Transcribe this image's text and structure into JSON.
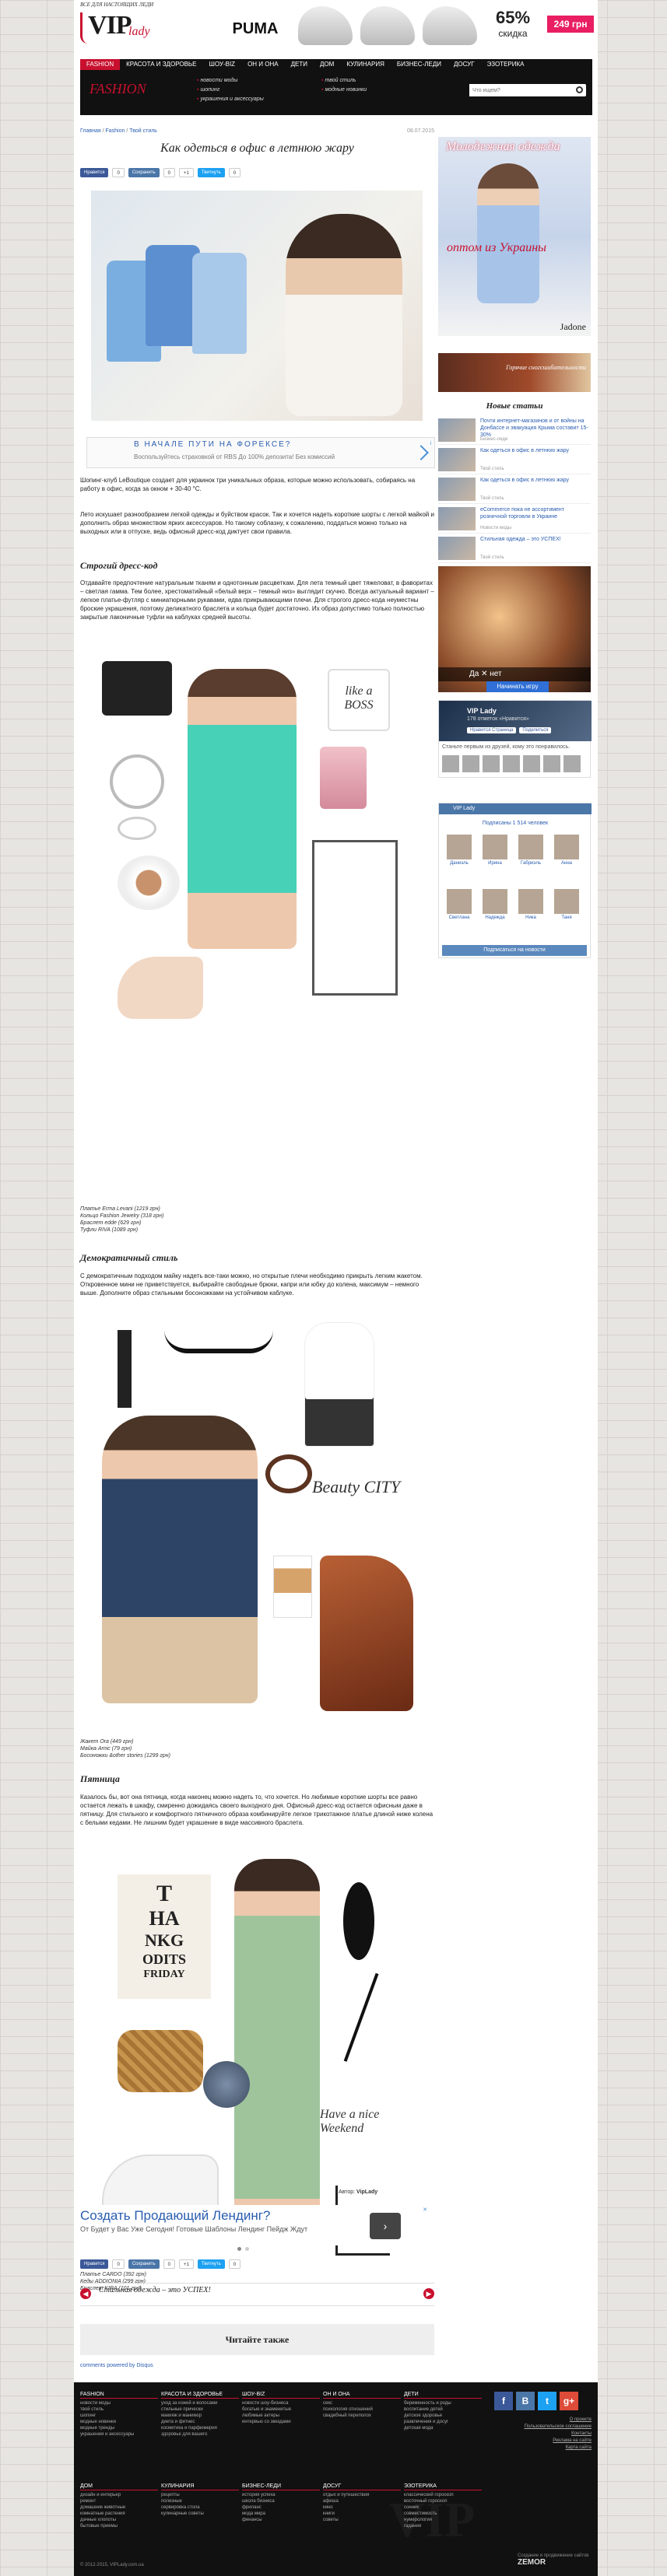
{
  "logo": {
    "tagline": "ВСЕ ДЛЯ НАСТОЯЩИХ ЛЕДИ",
    "vip": "VIP",
    "lady": "lady"
  },
  "banner": {
    "brand": "PUMA",
    "discount": "65%",
    "discount_label": "скидка",
    "price": "249 грн"
  },
  "nav": [
    "FASHION",
    "КРАСОТА И ЗДОРОВЬЕ",
    "ШОУ-BIZ",
    "ОН И ОНА",
    "ДЕТИ",
    "ДОМ",
    "КУЛИНАРИЯ",
    "БИЗНЕС-ЛЕДИ",
    "ДОСУГ",
    "ЭЗОТЕРИКА"
  ],
  "subnav": {
    "title": "FASHION",
    "col1": [
      "новости моды",
      "шопинг",
      "украшения и аксессуары"
    ],
    "col2": [
      "твой стиль",
      "модные новинки"
    ],
    "search_placeholder": "Что ищем?"
  },
  "breadcrumb": {
    "home": "Главная",
    "sep": " / ",
    "section": "Fashion",
    "sub": "Твой стиль"
  },
  "date": "08.07.2015",
  "title": "Как одеться в офис в летнюю жару",
  "share": {
    "fb": "Нравится",
    "fb_count": "0",
    "vk": "Сохранить",
    "vk_count": "0",
    "tw": "Твитнуть",
    "tw_count": "0",
    "plus": "+1"
  },
  "ad_small": {
    "title": "В НАЧАЛЕ ПУТИ НА ФОРЕКСЕ?",
    "sub": "Воспользуйтесь страховкой от RBS До 100% депозита! Без комиссий",
    "info": "i"
  },
  "intro": "Шопинг-клуб LeBoutique создает для украинок три уникальных образа, которые можно использовать, собираясь на работу в офис, когда за окном + 30-40 °С.",
  "para1": "Лето искушает разнообразием легкой одежды и буйством красок. Так и хочется надеть короткие шорты с легкой майкой и дополнить образ множеством ярких аксессуаров. Но такому соблазну, к сожалению, поддаться можно только на выходных или в отпуске, ведь офисный дресс-код диктует свои правила.",
  "section1": {
    "title": "Строгий дресс-код",
    "text": "Отдавайте предпочтение натуральным тканям и однотонным расцветкам. Для лета темный цвет тяжеловат, в фаворитах – светлая гамма. Тем более, хрестоматийный «белый верх – темный низ» выглядит скучно. Всегда актуальный вариант – легкое платье-футляр с миниатюрными рукавами, едва прикрывающими плечи. Для строгого дресс-кода неуместны броские украшения, поэтому деликатного браслета и кольца будет достаточно. Их образ допустимо только полностью закрытые лаконичные туфли на каблуках средней высоты.",
    "caps": [
      "Платье Erma Levani (1219 грн)",
      "Кольцо Fashion Jewelry (318 грн)",
      "Браслет edde (629 грн)",
      "Туфли RIVA (1089 грн)"
    ]
  },
  "section2": {
    "title": "Демократичный стиль",
    "text": "С демократичным подходом майку надеть все-таки можно, но открытые плечи необходимо прикрыть легким жакетом. Откровенное мини не приветствуется, выбирайте свободные брюки, капри или юбку до колена, максимум – немного выше. Дополните образ стильными босоножками на устойчивом каблуке.",
    "caps": [
      "Жакет Ora (449 грн)",
      "Майка Arnic (79 грн)",
      "Босоножки &other stories (1299 грн)"
    ]
  },
  "section3": {
    "title": "Пятница",
    "text": "Казалось бы, вот она пятница, когда наконец можно надеть то, что хочется. Но любимые короткие шорты все равно остается лежать в шкафу, смиренно дожидаясь своего выходного дня. Офисный дресс-код остается офисным даже в пятницу. Для стильного и комфортного пятничного образа комбинируйте легкое трикотажное платье длиной ниже колена с белыми кедами. Не лишним будет украшение в виде массивного браслета.",
    "caps": [
      "Платье CARDO (392 грн)",
      "Кеды ADDIONIA (299 грн)",
      "Браслет KIRA (101 грн)"
    ]
  },
  "collage_text": {
    "boss": "like a BOSS",
    "beauty": "Beauty CITY",
    "weekend": "Have a nice Weekend",
    "chart": [
      "T",
      "HA",
      "NKG",
      "ODITS",
      "FRIDAY"
    ]
  },
  "author": {
    "label": "Автор:",
    "name": "VipLady"
  },
  "ad_big": {
    "title": "Создать Продающий Лендинг?",
    "sub": "От Будет у Вас Уже Сегодня! Готовые Шаблоны Лендинг Пейдж Ждут",
    "x": "✕",
    "btn": "›"
  },
  "prev_post": {
    "text": "Стильная одежда – это УСПЕХ!"
  },
  "read_also": "Читайте также",
  "disqus": "comments powered by Disqus",
  "side": {
    "ad1": {
      "title": "Молодежная одежда",
      "offer": "оптом из Украины",
      "brand": "Jadone"
    },
    "ad2": {
      "text": "Горячие сногсшибательности"
    },
    "new_title": "Новые статьи",
    "news": [
      {
        "title": "Почти интернет-магазинов и от войны на Донбассе и эвакуация Крыма составит 15-30%",
        "cat": "Бизнес-леди"
      },
      {
        "title": "Как одеться в офис в летнюю жару",
        "cat": "Твой стиль"
      },
      {
        "title": "Как одеться в офис в летнюю жару",
        "cat": "Твой стиль"
      },
      {
        "title": "eCommerce пока не ассортимент розничной торговли в Украине",
        "cat": "Новости моды"
      },
      {
        "title": "Стильная одежда – это УСПЕХ!",
        "cat": "Твой стиль"
      }
    ],
    "ad3": {
      "bar": "Да  ✕  нет",
      "btn": "Начинать игру"
    },
    "fb": {
      "name": "VIP Lady",
      "count": "178 отметок «Нравится»",
      "like": "Нравится Страница",
      "share": "Поделиться",
      "friends": "Станьте первым из друзей, кому это понравилось."
    },
    "vk": {
      "title": "VIP Lady",
      "sub": "Подписаны 1 514 человек",
      "names": [
        "Даниэль",
        "Ирина",
        "Габриэль",
        "Анна",
        "Светлана",
        "Надежда",
        "Ника",
        "Таня"
      ],
      "btn": "Подписаться на новости"
    }
  },
  "footer": {
    "cols": [
      {
        "hd": "FASHION",
        "items": [
          "новости моды",
          "твой стиль",
          "шопинг",
          "модные новинки",
          "модные тренды",
          "украшения и аксессуары"
        ]
      },
      {
        "hd": "КРАСОТА И ЗДОРОВЬЕ",
        "items": [
          "уход за кожей и волосами",
          "стильные прически",
          "макияж и маникюр",
          "диета и фитнес",
          "косметика и парфюмерия",
          "здоровье для вашего"
        ]
      },
      {
        "hd": "ШОУ-BIZ",
        "items": [
          "новости шоу-бизнеса",
          "богатые и знаменитые",
          "любимые актеры",
          "интервью со звездами"
        ]
      },
      {
        "hd": "ОН И ОНА",
        "items": [
          "секс",
          "психология отношений",
          "свадебный переполох"
        ]
      },
      {
        "hd": "ДЕТИ",
        "items": [
          "беременность и роды",
          "воспитание детей",
          "детское здоровье",
          "развлечения и досуг",
          "детская мода"
        ]
      },
      {
        "hd": "ДОМ",
        "items": [
          "дизайн и интерьер",
          "ремонт",
          "домашние животные",
          "комнатные растения",
          "дачные хлопоты",
          "бытовые приемы"
        ]
      },
      {
        "hd": "КУЛИНАРИЯ",
        "items": [
          "рецепты",
          "полезные",
          "сервировка стола",
          "кулинарные советы"
        ]
      },
      {
        "hd": "БИЗНЕС-ЛЕДИ",
        "items": [
          "история успеха",
          "школа бизнеса",
          "фриланс",
          "мода мира",
          "финансы"
        ]
      },
      {
        "hd": "ДОСУГ",
        "items": [
          "отдых и путешествия",
          "афиша",
          "кино",
          "книги",
          "советы"
        ]
      },
      {
        "hd": "ЭЗОТЕРИКА",
        "items": [
          "классический гороскоп",
          "восточный гороскоп",
          "сонник",
          "совместимость",
          "нумерология",
          "гадания"
        ]
      }
    ],
    "links": [
      "О проекте",
      "Пользовательское соглашение",
      "Контакты",
      "Реклама на сайте",
      "Карта сайта"
    ],
    "copyright": "© 2012-2015, VIPLady.com.ua",
    "dev_label": "Создание и продвижение сайтов",
    "dev": "ZEMOR"
  }
}
